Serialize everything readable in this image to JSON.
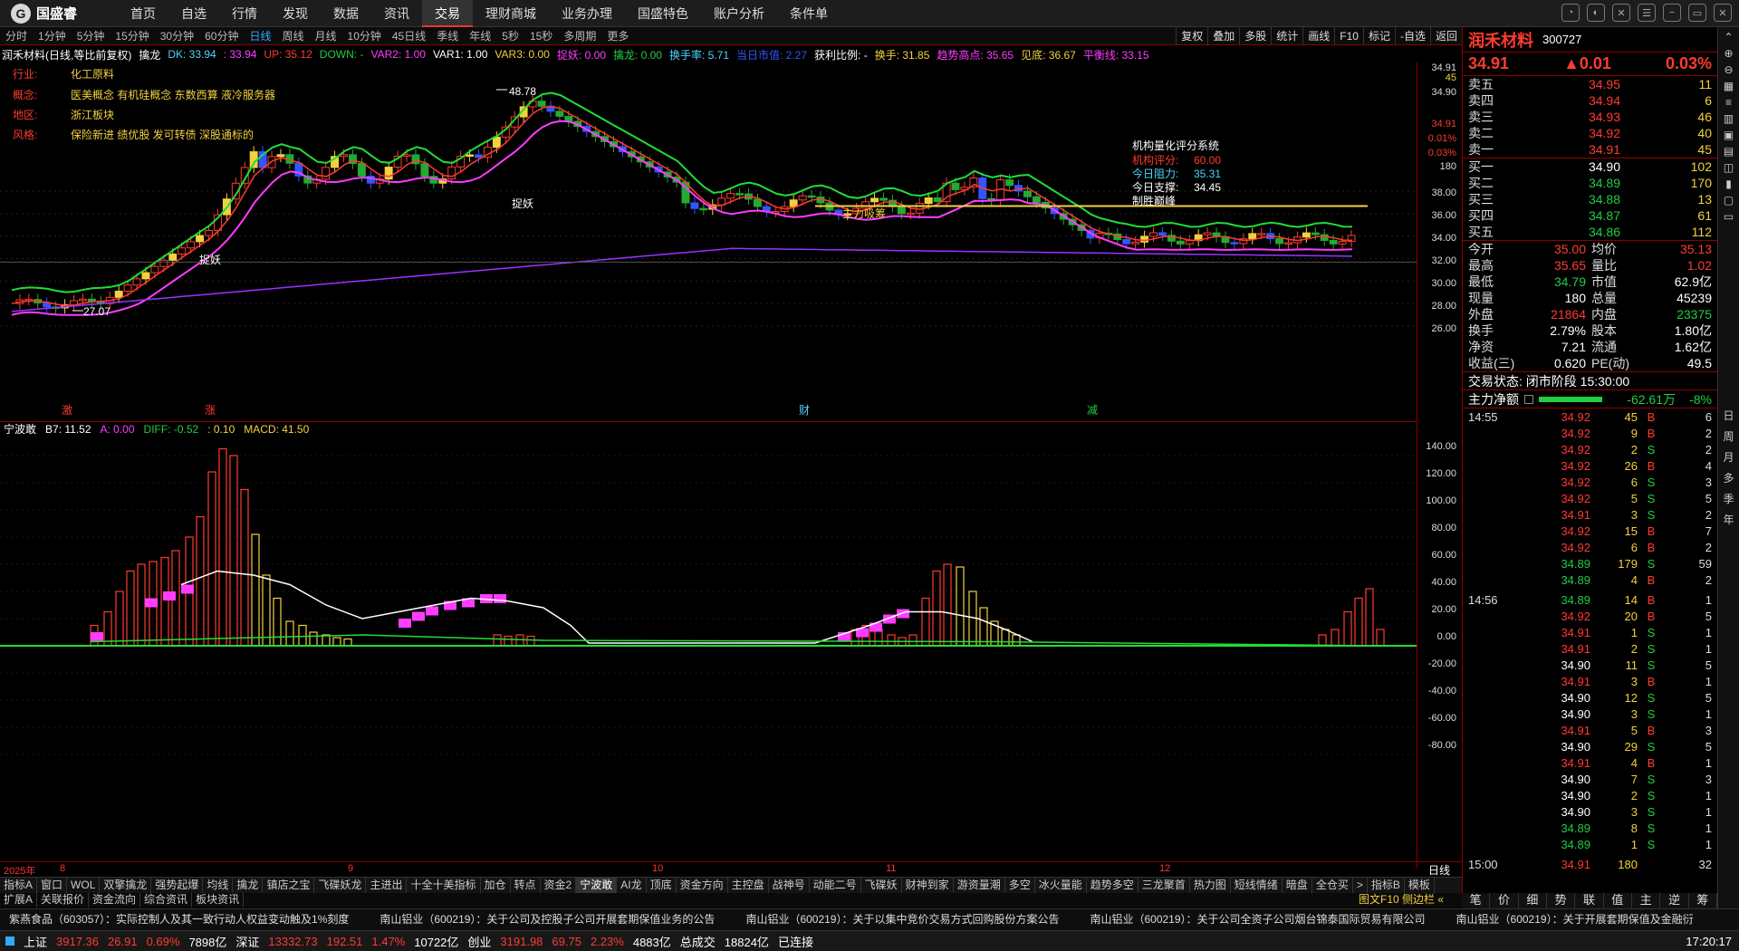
{
  "app": {
    "name": "国盛睿",
    "menu": [
      "首页",
      "自选",
      "行情",
      "发现",
      "数据",
      "资讯",
      "交易",
      "理财商城",
      "业务办理",
      "国盛特色",
      "账户分析",
      "条件单"
    ],
    "active": "交易"
  },
  "periods": [
    "分时",
    "1分钟",
    "5分钟",
    "15分钟",
    "30分钟",
    "60分钟",
    "日线",
    "周线",
    "月线",
    "10分钟",
    "45日线",
    "季线",
    "年线",
    "5秒",
    "15秒",
    "多周期",
    "更多"
  ],
  "active_period": "日线",
  "tools": [
    "复权",
    "叠加",
    "多股",
    "统计",
    "画线",
    "F10",
    "标记",
    "-自选",
    "返回"
  ],
  "stock": {
    "title": "润禾材料(日线,等比前复权)",
    "name": "润禾材料",
    "code": "300727",
    "indicator": "擒龙"
  },
  "indicators": [
    {
      "t": "DK: 33.94",
      "c": "#4ad6ff"
    },
    {
      "t": ": 33.94",
      "c": "#ff3cff"
    },
    {
      "t": "UP: 35.12",
      "c": "#ff3b30"
    },
    {
      "t": "DOWN: -",
      "c": "#22cc44"
    },
    {
      "t": "VAR2: 1.00",
      "c": "#ff3cff"
    },
    {
      "t": "VAR1: 1.00",
      "c": "#fff"
    },
    {
      "t": "VAR3: 0.00",
      "c": "#f4d03f"
    },
    {
      "t": "捉妖: 0.00",
      "c": "#ff3cff"
    },
    {
      "t": "擒龙: 0.00",
      "c": "#22cc44"
    },
    {
      "t": "换手率: 5.71",
      "c": "#4ad6ff"
    },
    {
      "t": "当日市值: 2.27",
      "c": "#3355ff"
    },
    {
      "t": "获利比例: -",
      "c": "#fff"
    },
    {
      "t": "换手: 31.85",
      "c": "#f4d03f"
    },
    {
      "t": "趋势高点: 35.65",
      "c": "#ff3cff"
    },
    {
      "t": "见底: 36.67",
      "c": "#f4d03f"
    },
    {
      "t": "平衡线: 33.15",
      "c": "#ff3cff"
    }
  ],
  "info": [
    {
      "k": "行业:",
      "v": "化工原料"
    },
    {
      "k": "概念:",
      "v": "医美概念 有机硅概念 东数西算 液冷服务器"
    },
    {
      "k": "地区:",
      "v": "浙江板块"
    },
    {
      "k": "风格:",
      "v": "保险新进 绩优股 发可转债 深股通标的"
    }
  ],
  "score": {
    "title": "机构量化评分系统",
    "items": [
      {
        "k": "机构评分:",
        "v": "60.00",
        "c": "#ff3b30"
      },
      {
        "k": "今日阻力:",
        "v": "35.31",
        "c": "#4ad6ff"
      },
      {
        "k": "今日支撑:",
        "v": "34.45",
        "c": "#fff"
      }
    ],
    "note": "制胜巅峰"
  },
  "annotations": {
    "high": "48.78",
    "low": "27.07",
    "catch1": "捉妖",
    "catch2": "捉妖",
    "main_inflow": "主力吸筹",
    "fin": "财",
    "zhang": "涨",
    "jian": "减",
    "yi": "激"
  },
  "y_axis_main": [
    "34.91",
    "45",
    "34.90",
    "34.91",
    "0.01%",
    "0.03%",
    "180",
    "38.00",
    "36.00",
    "34.00",
    "32.00",
    "30.00",
    "28.00",
    "26.00"
  ],
  "sub": {
    "name": "宁波敢",
    "items": [
      {
        "t": "B7: 11.52",
        "c": "#fff"
      },
      {
        "t": "A: 0.00",
        "c": "#ff3cff"
      },
      {
        "t": "DIFF: -0.52",
        "c": "#22cc44"
      },
      {
        "t": ": 0.10",
        "c": "#f4d03f"
      },
      {
        "t": "MACD: 41.50",
        "c": "#f4d03f"
      }
    ]
  },
  "y_axis_sub": [
    "140.00",
    "120.00",
    "100.00",
    "80.00",
    "60.00",
    "40.00",
    "20.00",
    "0.00",
    "-20.00",
    "-40.00",
    "-60.00",
    "-80.00"
  ],
  "date_labels": [
    {
      "t": "2025年",
      "x": 4
    },
    {
      "t": "8",
      "x": 66
    },
    {
      "t": "9",
      "x": 384
    },
    {
      "t": "10",
      "x": 720
    },
    {
      "t": "11",
      "x": 978
    },
    {
      "t": "12",
      "x": 1280
    }
  ],
  "day_label": "日线",
  "tabs": [
    "指标A",
    "窗口",
    "WOL",
    "双擎擒龙",
    "强势起爆",
    "均线",
    "擒龙",
    "镇店之宝",
    "飞碟妖龙",
    "主进出",
    "十全十美指标",
    "加仓",
    "转点",
    "资金2",
    "宁波敢",
    "AI龙",
    "顶底",
    "资金方向",
    "主控盘",
    "战神号",
    "动能二号",
    "飞碟妖",
    "财神到家",
    "游资量潮",
    "多空",
    "冰火量能",
    "趋势多空",
    "三龙聚首",
    "热力图",
    "短线情绪",
    "暗盘",
    "全仓买"
  ],
  "active_tab": "宁波敢",
  "tabs_end": [
    "指标B",
    "模板"
  ],
  "tabs2": [
    "扩展A",
    "关联报价",
    "资金流向",
    "综合资讯",
    "板块资讯"
  ],
  "tabs2_right": "图文F10 侧边栏 «",
  "panel": {
    "price": "34.91",
    "change": "▲0.01",
    "pct": "0.03%",
    "asks": [
      {
        "l": "卖五",
        "p": "34.95",
        "v": "11"
      },
      {
        "l": "卖四",
        "p": "34.94",
        "v": "6"
      },
      {
        "l": "卖三",
        "p": "34.93",
        "v": "46"
      },
      {
        "l": "卖二",
        "p": "34.92",
        "v": "40"
      },
      {
        "l": "卖一",
        "p": "34.91",
        "v": "45"
      }
    ],
    "bids": [
      {
        "l": "买一",
        "p": "34.90",
        "v": "102"
      },
      {
        "l": "买二",
        "p": "34.89",
        "v": "170"
      },
      {
        "l": "买三",
        "p": "34.88",
        "v": "13"
      },
      {
        "l": "买四",
        "p": "34.87",
        "v": "61"
      },
      {
        "l": "买五",
        "p": "34.86",
        "v": "112"
      }
    ],
    "quote": [
      {
        "a": "今开",
        "b": "35.00",
        "bc": "up",
        "c": "均价",
        "d": "35.13",
        "dc": "up"
      },
      {
        "a": "最高",
        "b": "35.65",
        "bc": "up",
        "c": "量比",
        "d": "1.02",
        "dc": "up"
      },
      {
        "a": "最低",
        "b": "34.79",
        "bc": "dn",
        "c": "市值",
        "d": "62.9亿",
        "dc": "wh"
      },
      {
        "a": "现量",
        "b": "180",
        "bc": "wh",
        "c": "总量",
        "d": "45239",
        "dc": "wh"
      },
      {
        "a": "外盘",
        "b": "21864",
        "bc": "up",
        "c": "内盘",
        "d": "23375",
        "dc": "dn"
      },
      {
        "a": "换手",
        "b": "2.79%",
        "bc": "wh",
        "c": "股本",
        "d": "1.80亿",
        "dc": "wh"
      },
      {
        "a": "净资",
        "b": "7.21",
        "bc": "wh",
        "c": "流通",
        "d": "1.62亿",
        "dc": "wh"
      },
      {
        "a": "收益(三)",
        "b": "0.620",
        "bc": "wh",
        "c": "PE(动)",
        "d": "49.5",
        "dc": "wh"
      }
    ],
    "trade_state": "交易状态: 闭市阶段 15:30:00",
    "net_label": "主力净额",
    "net_val": "-62.61万",
    "net_pct": "-8%",
    "ticks": [
      {
        "t": "14:55",
        "p": "34.92",
        "c": "up",
        "v": "45",
        "bs": "B",
        "n": "6"
      },
      {
        "t": "",
        "p": "34.92",
        "c": "up",
        "v": "9",
        "bs": "B",
        "n": "2"
      },
      {
        "t": "",
        "p": "34.92",
        "c": "up",
        "v": "2",
        "bs": "S",
        "n": "2"
      },
      {
        "t": "",
        "p": "34.92",
        "c": "up",
        "v": "26",
        "bs": "B",
        "n": "4"
      },
      {
        "t": "",
        "p": "34.92",
        "c": "up",
        "v": "6",
        "bs": "S",
        "n": "3"
      },
      {
        "t": "",
        "p": "34.92",
        "c": "up",
        "v": "5",
        "bs": "S",
        "n": "5"
      },
      {
        "t": "",
        "p": "34.91",
        "c": "up",
        "v": "3",
        "bs": "S",
        "n": "2"
      },
      {
        "t": "",
        "p": "34.92",
        "c": "up",
        "v": "15",
        "bs": "B",
        "n": "7"
      },
      {
        "t": "",
        "p": "34.92",
        "c": "up",
        "v": "6",
        "bs": "B",
        "n": "2"
      },
      {
        "t": "",
        "p": "34.89",
        "c": "dn",
        "v": "179",
        "bs": "S",
        "n": "59"
      },
      {
        "t": "",
        "p": "34.89",
        "c": "dn",
        "v": "4",
        "bs": "B",
        "n": "2"
      },
      {
        "t": "14:56",
        "p": "34.89",
        "c": "dn",
        "v": "14",
        "bs": "B",
        "n": "1"
      },
      {
        "t": "",
        "p": "34.92",
        "c": "up",
        "v": "20",
        "bs": "B",
        "n": "5"
      },
      {
        "t": "",
        "p": "34.91",
        "c": "up",
        "v": "1",
        "bs": "S",
        "n": "1"
      },
      {
        "t": "",
        "p": "34.91",
        "c": "up",
        "v": "2",
        "bs": "S",
        "n": "1"
      },
      {
        "t": "",
        "p": "34.90",
        "c": "wh",
        "v": "11",
        "bs": "S",
        "n": "5"
      },
      {
        "t": "",
        "p": "34.91",
        "c": "up",
        "v": "3",
        "bs": "B",
        "n": "1"
      },
      {
        "t": "",
        "p": "34.90",
        "c": "wh",
        "v": "12",
        "bs": "S",
        "n": "5"
      },
      {
        "t": "",
        "p": "34.90",
        "c": "wh",
        "v": "3",
        "bs": "S",
        "n": "1"
      },
      {
        "t": "",
        "p": "34.91",
        "c": "up",
        "v": "5",
        "bs": "B",
        "n": "3"
      },
      {
        "t": "",
        "p": "34.90",
        "c": "wh",
        "v": "29",
        "bs": "S",
        "n": "5"
      },
      {
        "t": "",
        "p": "34.91",
        "c": "up",
        "v": "4",
        "bs": "B",
        "n": "1"
      },
      {
        "t": "",
        "p": "34.90",
        "c": "wh",
        "v": "7",
        "bs": "S",
        "n": "3"
      },
      {
        "t": "",
        "p": "34.90",
        "c": "wh",
        "v": "2",
        "bs": "S",
        "n": "1"
      },
      {
        "t": "",
        "p": "34.90",
        "c": "wh",
        "v": "3",
        "bs": "S",
        "n": "1"
      },
      {
        "t": "",
        "p": "34.89",
        "c": "dn",
        "v": "8",
        "bs": "S",
        "n": "1"
      },
      {
        "t": "",
        "p": "34.89",
        "c": "dn",
        "v": "1",
        "bs": "S",
        "n": "1"
      },
      {
        "t": "15:00",
        "p": "34.91",
        "c": "up",
        "v": "180",
        "bs": "",
        "n": "32"
      }
    ],
    "bottom_tabs": [
      "笔",
      "价",
      "细",
      "势",
      "联",
      "值",
      "主",
      "逆",
      "筹"
    ]
  },
  "sidebar": [
    "日",
    "周",
    "月",
    "多",
    "季",
    "年"
  ],
  "news": [
    "紫燕食品（603057）：实际控制人及其一致行动人权益变动触及1%刻度",
    "南山铝业（600219）：关于公司及控股子公司开展套期保值业务的公告",
    "南山铝业（600219）：关于以集中竞价交易方式回购股份方案公告",
    "南山铝业（600219）：关于公司全资子公司烟台锦泰国际贸易有限公司",
    "南山铝业（600219）：关于开展套期保值及金融衍"
  ],
  "status": {
    "sh_name": "上证",
    "sh": "3917.36",
    "sh_chg": "26.91",
    "sh_pct": "0.69%",
    "sh_amt": "7898亿",
    "sz_name": "深证",
    "sz": "13332.73",
    "sz_chg": "192.51",
    "sz_pct": "1.47%",
    "sz_amt": "10722亿",
    "cy_name": "创业",
    "cy": "3191.98",
    "cy_chg": "69.75",
    "cy_pct": "2.23%",
    "cy_amt": "4883亿",
    "total_label": "总成交",
    "total": "18824亿",
    "conn": "已连接",
    "time": "17:20:17"
  },
  "chart_data": {
    "type": "candlestick",
    "title": "润禾材料(日线,等比前复权)",
    "ylim": [
      26,
      49
    ],
    "high_marker": 48.78,
    "low_marker": 27.07,
    "resistance_line": 36.67,
    "series": [
      {
        "name": "宁波敢 MACD",
        "ylim": [
          -80,
          140
        ]
      }
    ]
  }
}
